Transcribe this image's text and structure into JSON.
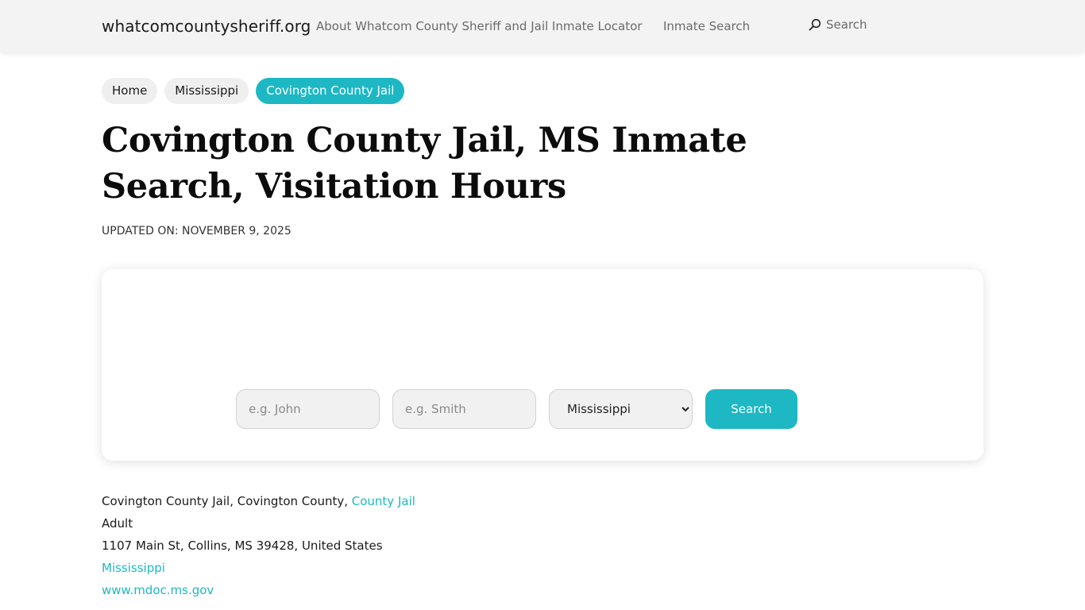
{
  "header": {
    "site_name": "whatcomcountysheriff.org",
    "nav": {
      "about": "About Whatcom County Sheriff and Jail Inmate Locator",
      "inmate_search": "Inmate Search",
      "search": "Search"
    }
  },
  "breadcrumb": [
    "Home",
    "Mississippi",
    "Covington County Jail"
  ],
  "page": {
    "title": "Covington County Jail, MS Inmate Search, Visitation Hours",
    "updated": "UPDATED ON: NOVEMBER 9, 2025"
  },
  "search_form": {
    "first_name_placeholder": "e.g. John",
    "last_name_placeholder": "e.g. Smith",
    "state_selected": "Mississippi",
    "button_label": "Search"
  },
  "facility": {
    "name_text": "Covington County Jail, Covington County, ",
    "type_link": "County Jail",
    "category": "Adult",
    "address": "1107 Main St, Collins, MS 39428, United States",
    "state_link": "Mississippi",
    "website_link": "www.mdoc.ms.gov"
  },
  "colors": {
    "accent": "#1db8c4",
    "header_bg": "#f3f3f3"
  }
}
